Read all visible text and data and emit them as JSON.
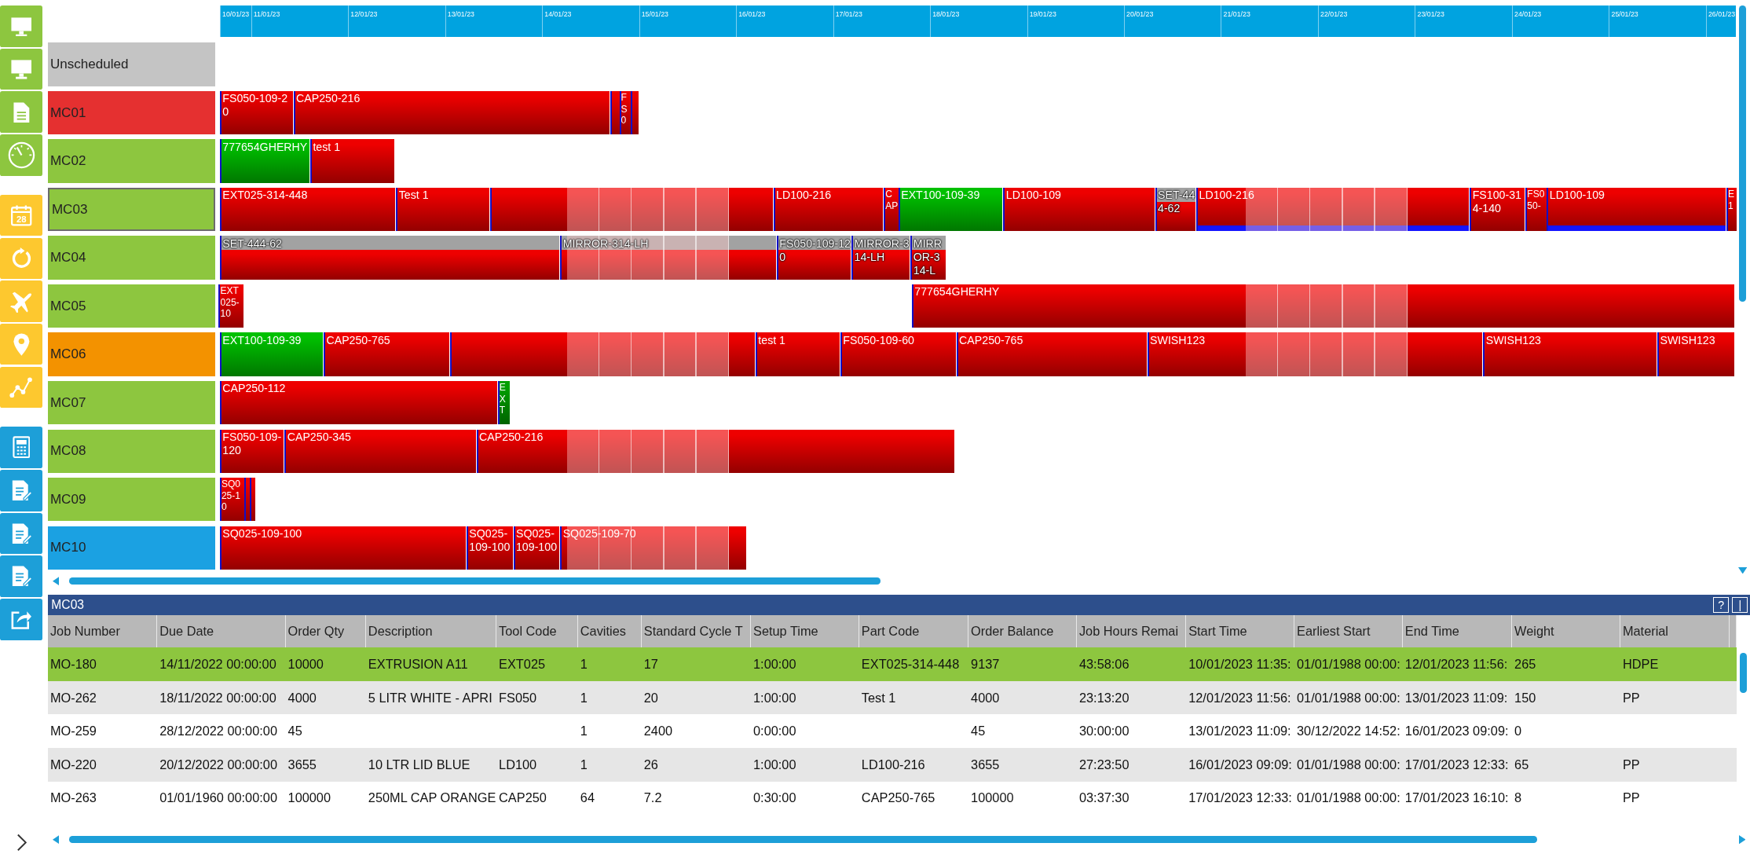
{
  "sidebar": {
    "groups": [
      {
        "color": "#8dc63f",
        "items": [
          {
            "kind": "monitor"
          },
          {
            "kind": "monitor"
          },
          {
            "kind": "document"
          },
          {
            "kind": "gauge"
          }
        ]
      },
      {
        "color": "#fdc82f",
        "items": [
          {
            "kind": "calendar",
            "text": "28"
          },
          {
            "kind": "refresh"
          },
          {
            "kind": "airplane"
          },
          {
            "kind": "pin"
          },
          {
            "kind": "graph"
          }
        ]
      },
      {
        "color": "#1d9fd8",
        "items": [
          {
            "kind": "calculator"
          },
          {
            "kind": "checklist"
          },
          {
            "kind": "checklist"
          },
          {
            "kind": "checklist"
          },
          {
            "kind": "share"
          }
        ]
      }
    ]
  },
  "timeline": {
    "dates": [
      "10/01/23",
      "11/01/23",
      "12/01/23",
      "13/01/23",
      "14/01/23",
      "15/01/23",
      "16/01/23",
      "17/01/23",
      "18/01/23",
      "19/01/23",
      "20/01/23",
      "21/01/23",
      "22/01/23",
      "23/01/23",
      "24/01/23",
      "25/01/23",
      "26/01/23"
    ]
  },
  "resources": [
    {
      "name": "Unscheduled",
      "color": "#c4c4c4",
      "selected": false
    },
    {
      "name": "MC01",
      "color": "#e53030",
      "selected": false,
      "bars": [
        {
          "label": "FS050-109-20",
          "color": "#ee0000",
          "kind": "plain"
        },
        {
          "label": "CAP250-216",
          "color": "#ee0000",
          "kind": "plain"
        },
        {
          "color": "#ee0000",
          "kind": "plain"
        },
        {
          "label": "FS0",
          "color": "#ee0000",
          "kind": "plain"
        },
        {
          "color": "#ee0000",
          "kind": "plain"
        }
      ]
    },
    {
      "name": "MC02",
      "color": "#8dc63f",
      "selected": false,
      "bars": [
        {
          "label": "777654GHERHY",
          "color": "#00c000",
          "kind": "plain"
        },
        {
          "label": "test 1",
          "color": "#ee0000",
          "kind": "plain"
        }
      ]
    },
    {
      "name": "MC03",
      "color": "#8dc63f",
      "selected": true,
      "bars": [
        {
          "label": "EXT025-314-448",
          "color": "#ee0000",
          "kind": "plain"
        },
        {
          "label": "Test 1",
          "color": "#ee0000",
          "kind": "plain"
        },
        {
          "color": "#ee0000",
          "kind": "plain"
        },
        {
          "label": "LD100-216",
          "color": "#ee0000",
          "kind": "plain"
        },
        {
          "label": "CAP",
          "color": "#ee0000",
          "kind": "plain"
        },
        {
          "label": "EXT100-109-39",
          "color": "#00c000",
          "kind": "plain"
        },
        {
          "label": "LD100-109",
          "color": "#ee0000",
          "kind": "plain"
        },
        {
          "label": "SET-444-62",
          "color": "#ee0000",
          "kind": "banded"
        },
        {
          "label": "LD100-216",
          "color": "#ee0000",
          "kind": "underlined"
        },
        {
          "label": "FS100-314-140",
          "color": "#ee0000",
          "kind": "plain"
        },
        {
          "label": "FS050-",
          "color": "#ee0000",
          "kind": "plain"
        },
        {
          "label": "LD100-109",
          "color": "#ee0000",
          "kind": "underlined"
        },
        {
          "label": "E1",
          "color": "#ee0000",
          "kind": "plain"
        }
      ]
    },
    {
      "name": "MC04",
      "color": "#8dc63f",
      "selected": false,
      "bars": [
        {
          "label": "SET-444-62",
          "color": "#ee0000",
          "kind": "banded"
        },
        {
          "label": "MIRROR-314-LH",
          "color": "#ee0000",
          "kind": "banded"
        },
        {
          "label": "FS050-109-120",
          "color": "#ee0000",
          "kind": "banded"
        },
        {
          "label": "MIRROR-314-LH",
          "color": "#ee0000",
          "kind": "banded"
        },
        {
          "label": "MIRROR-314-L",
          "color": "#ee0000",
          "kind": "banded"
        }
      ]
    },
    {
      "name": "MC05",
      "color": "#8dc63f",
      "selected": false,
      "bars": [
        {
          "label": "EXT025-10",
          "color": "#ee0000",
          "kind": "plain"
        },
        {
          "label": "777654GHERHY",
          "color": "#ee0000",
          "kind": "plain"
        }
      ]
    },
    {
      "name": "MC06",
      "color": "#f39200",
      "selected": false,
      "bars": [
        {
          "label": "EXT100-109-39",
          "color": "#00c000",
          "kind": "plain"
        },
        {
          "label": "CAP250-765",
          "color": "#ee0000",
          "kind": "plain"
        },
        {
          "color": "#ee0000",
          "kind": "plain"
        },
        {
          "label": "test 1",
          "color": "#ee0000",
          "kind": "plain"
        },
        {
          "label": "FS050-109-60",
          "color": "#ee0000",
          "kind": "plain"
        },
        {
          "label": "CAP250-765",
          "color": "#ee0000",
          "kind": "plain"
        },
        {
          "label": "SWISH123",
          "color": "#ee0000",
          "kind": "plain"
        },
        {
          "label": "SWISH123",
          "color": "#ee0000",
          "kind": "plain"
        },
        {
          "label": "SWISH123",
          "color": "#ee0000",
          "kind": "plain"
        }
      ]
    },
    {
      "name": "MC07",
      "color": "#8dc63f",
      "selected": false,
      "bars": [
        {
          "label": "CAP250-112",
          "color": "#ee0000",
          "kind": "plain"
        },
        {
          "label": "EXT",
          "color": "#00a000",
          "kind": "plain"
        }
      ]
    },
    {
      "name": "MC08",
      "color": "#8dc63f",
      "selected": false,
      "bars": [
        {
          "label": "FS050-109-120",
          "color": "#ee0000",
          "kind": "plain"
        },
        {
          "label": "CAP250-345",
          "color": "#ee0000",
          "kind": "plain"
        },
        {
          "label": "CAP250-216",
          "color": "#ee0000",
          "kind": "plain"
        }
      ]
    },
    {
      "name": "MC09",
      "color": "#8dc63f",
      "selected": false,
      "bars": [
        {
          "label": "SQ025-10",
          "color": "#ee0000",
          "kind": "plain"
        },
        {
          "color": "#ee0000",
          "kind": "plain"
        },
        {
          "color": "#ee0000",
          "kind": "plain"
        }
      ]
    },
    {
      "name": "MC10",
      "color": "#1ba1e2",
      "selected": false,
      "bars": [
        {
          "label": "SQ025-109-100",
          "color": "#ee0000",
          "kind": "plain"
        },
        {
          "label": "SQ025-109-100",
          "color": "#ee0000",
          "kind": "plain"
        },
        {
          "label": "SQ025-109-100",
          "color": "#ee0000",
          "kind": "plain"
        },
        {
          "label": "SQ025-109-70",
          "color": "#ee0000",
          "kind": "plain"
        }
      ]
    }
  ],
  "detail_panel": {
    "title": "MC03",
    "buttons": [
      "?",
      "|"
    ],
    "columns": [
      "Job Number",
      "Due Date",
      "Order Qty",
      "Description",
      "Tool Code",
      "Cavities",
      "Standard Cycle T",
      "Setup Time",
      "Part Code",
      "Order Balance",
      "Job Hours Remai",
      "Start Time",
      "Earliest Start",
      "End Time",
      "Weight",
      "Material"
    ],
    "rows": [
      {
        "selected": true,
        "cells": [
          "MO-180",
          "14/11/2022 00:00:00",
          "10000",
          "EXTRUSION A11",
          "EXT025",
          "1",
          "17",
          "1:00:00",
          "EXT025-314-448",
          "9137",
          "43:58:06",
          "10/01/2023 11:35:",
          "01/01/1988 00:00:",
          "12/01/2023 11:56:",
          "265",
          "HDPE"
        ]
      },
      {
        "selected": false,
        "cells": [
          "MO-262",
          "18/11/2022 00:00:00",
          "4000",
          "5 LITR WHITE - APRI",
          "FS050",
          "1",
          "20",
          "1:00:00",
          "Test 1",
          "4000",
          "23:13:20",
          "12/01/2023 11:56:",
          "01/01/1988 00:00:",
          "13/01/2023 11:09:",
          "150",
          "PP"
        ]
      },
      {
        "selected": false,
        "cells": [
          "MO-259",
          "28/12/2022 00:00:00",
          "45",
          null,
          null,
          "1",
          "2400",
          "0:00:00",
          null,
          "45",
          "30:00:00",
          "13/01/2023 11:09:",
          "30/12/2022 14:52:",
          "16/01/2023 09:09:",
          "0",
          null
        ]
      },
      {
        "selected": false,
        "cells": [
          "MO-220",
          "20/12/2022 00:00:00",
          "3655",
          "10 LTR LID BLUE",
          "LD100",
          "1",
          "26",
          "1:00:00",
          "LD100-216",
          "3655",
          "27:23:50",
          "16/01/2023 09:09:",
          "01/01/1988 00:00:",
          "17/01/2023 12:33:",
          "65",
          "PP"
        ]
      },
      {
        "selected": false,
        "cells": [
          "MO-263",
          "01/01/1960 00:00:00",
          "100000",
          "250ML CAP ORANGE",
          "CAP250",
          "64",
          "7.2",
          "0:30:00",
          "CAP250-765",
          "100000",
          "03:37:30",
          "17/01/2023 12:33:",
          "01/01/1988 00:00:",
          "17/01/2023 16:10:",
          "8",
          "PP"
        ]
      }
    ]
  }
}
